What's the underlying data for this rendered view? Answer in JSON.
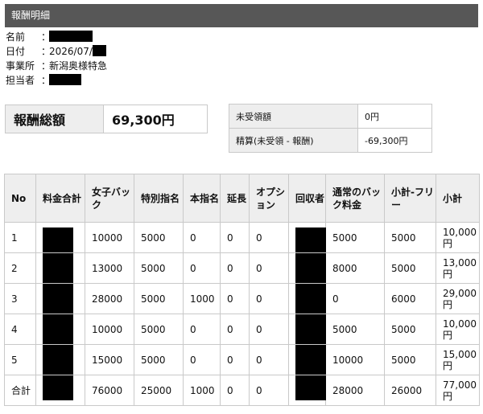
{
  "title": "報酬明細",
  "info": {
    "name_label": "名前",
    "date_label": "日付",
    "date_value": "2026/07/",
    "office_label": "事業所",
    "office_value": "新潟奥様特急",
    "staff_label": "担当者",
    "colon": "："
  },
  "summary": {
    "total_label": "報酬総額",
    "total_value": "69,300円",
    "unreceived_label": "未受領額",
    "unreceived_value": "0円",
    "settle_label": "精算(未受領 - 報酬)",
    "settle_value": "-69,300円"
  },
  "table": {
    "headers": [
      "No",
      "料金合計",
      "女子バック",
      "特別指名",
      "本指名",
      "延長",
      "オプション",
      "回収者",
      "通常のバック料金",
      "小計-フリー",
      "小計"
    ],
    "rows": [
      {
        "no": "1",
        "girl_back": "10000",
        "special": "5000",
        "main": "0",
        "ext": "0",
        "opt": "0",
        "normal_back": "5000",
        "free": "5000",
        "subtotal": "10,000円"
      },
      {
        "no": "2",
        "girl_back": "13000",
        "special": "5000",
        "main": "0",
        "ext": "0",
        "opt": "0",
        "normal_back": "8000",
        "free": "5000",
        "subtotal": "13,000円"
      },
      {
        "no": "3",
        "girl_back": "28000",
        "special": "5000",
        "main": "1000",
        "ext": "0",
        "opt": "0",
        "normal_back": "0",
        "free": "6000",
        "subtotal": "29,000円"
      },
      {
        "no": "4",
        "girl_back": "10000",
        "special": "5000",
        "main": "0",
        "ext": "0",
        "opt": "0",
        "normal_back": "5000",
        "free": "5000",
        "subtotal": "10,000円"
      },
      {
        "no": "5",
        "girl_back": "15000",
        "special": "5000",
        "main": "0",
        "ext": "0",
        "opt": "0",
        "normal_back": "10000",
        "free": "5000",
        "subtotal": "15,000円"
      },
      {
        "no": "合計",
        "girl_back": "76000",
        "special": "25000",
        "main": "1000",
        "ext": "0",
        "opt": "0",
        "normal_back": "28000",
        "free": "26000",
        "subtotal": "77,000円"
      }
    ]
  }
}
